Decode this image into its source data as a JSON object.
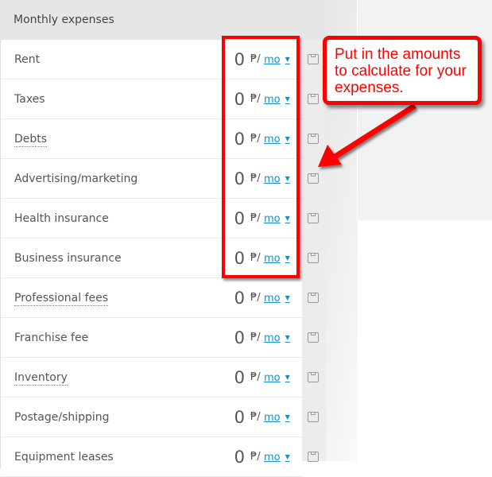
{
  "panel": {
    "title": "Monthly expenses",
    "rows": [
      {
        "label": "Rent",
        "amount": "0",
        "currency": "₱/",
        "period": "mo",
        "dotted": false
      },
      {
        "label": "Taxes",
        "amount": "0",
        "currency": "₱/",
        "period": "mo",
        "dotted": false
      },
      {
        "label": "Debts",
        "amount": "0",
        "currency": "₱/",
        "period": "mo",
        "dotted": true
      },
      {
        "label": "Advertising/marketing",
        "amount": "0",
        "currency": "₱/",
        "period": "mo",
        "dotted": false
      },
      {
        "label": "Health insurance",
        "amount": "0",
        "currency": "₱/",
        "period": "mo",
        "dotted": false
      },
      {
        "label": "Business insurance",
        "amount": "0",
        "currency": "₱/",
        "period": "mo",
        "dotted": false
      },
      {
        "label": "Professional fees",
        "amount": "0",
        "currency": "₱/",
        "period": "mo",
        "dotted": true
      },
      {
        "label": "Franchise fee",
        "amount": "0",
        "currency": "₱/",
        "period": "mo",
        "dotted": false
      },
      {
        "label": "Inventory",
        "amount": "0",
        "currency": "₱/",
        "period": "mo",
        "dotted": true
      },
      {
        "label": "Postage/shipping",
        "amount": "0",
        "currency": "₱/",
        "period": "mo",
        "dotted": false
      },
      {
        "label": "Equipment leases",
        "amount": "0",
        "currency": "₱/",
        "period": "mo",
        "dotted": false
      }
    ]
  },
  "annotation": {
    "text": "Put in the amounts to calculate for your expenses.",
    "color": "#ff0000"
  },
  "colors": {
    "link": "#1a8fc4",
    "text": "#555555"
  }
}
